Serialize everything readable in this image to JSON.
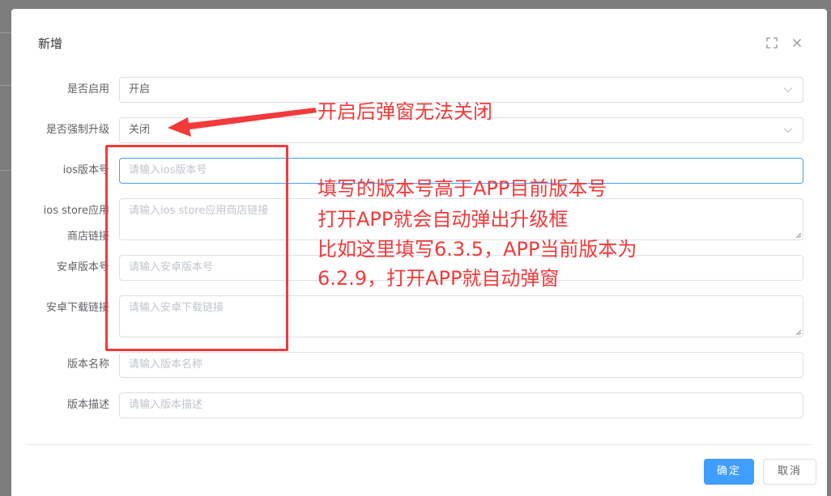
{
  "dialog": {
    "title": "新增",
    "fullscreen_icon": "fullscreen-icon",
    "close_icon": "close-icon"
  },
  "form": {
    "enabled": {
      "label": "是否启用",
      "value": "开启"
    },
    "force_upgrade": {
      "label": "是否强制升级",
      "value": "关闭"
    },
    "ios_version": {
      "label": "ios版本号",
      "placeholder": "请输入ios版本号"
    },
    "ios_store_link": {
      "label_line1": "ios store应用",
      "label_line2": "商店链接",
      "placeholder": "请输入ios store应用商店链接"
    },
    "android_version": {
      "label": "安卓版本号",
      "placeholder": "请输入安卓版本号"
    },
    "android_download": {
      "label": "安卓下载链接",
      "placeholder": "请输入安卓下载链接"
    },
    "version_name": {
      "label": "版本名称",
      "placeholder": "请输入版本名称"
    },
    "version_desc": {
      "label": "版本描述",
      "placeholder": "请输入版本描述"
    }
  },
  "footer": {
    "confirm_label": "确定",
    "cancel_label": "取消"
  },
  "annotations": {
    "arrow_note": "开启后弹窗无法关闭",
    "note_line1": "填写的版本号高于APP目前版本号",
    "note_line2": "打开APP就会自动弹出升级框",
    "note_line3": "比如这里填写6.3.5，APP当前版本为",
    "note_line4": "6.2.9，打开APP就自动弹窗",
    "color": "#f23a3a"
  },
  "colors": {
    "primary": "#409eff",
    "border": "#dcdfe6",
    "overlay": "#7d7d7d"
  }
}
